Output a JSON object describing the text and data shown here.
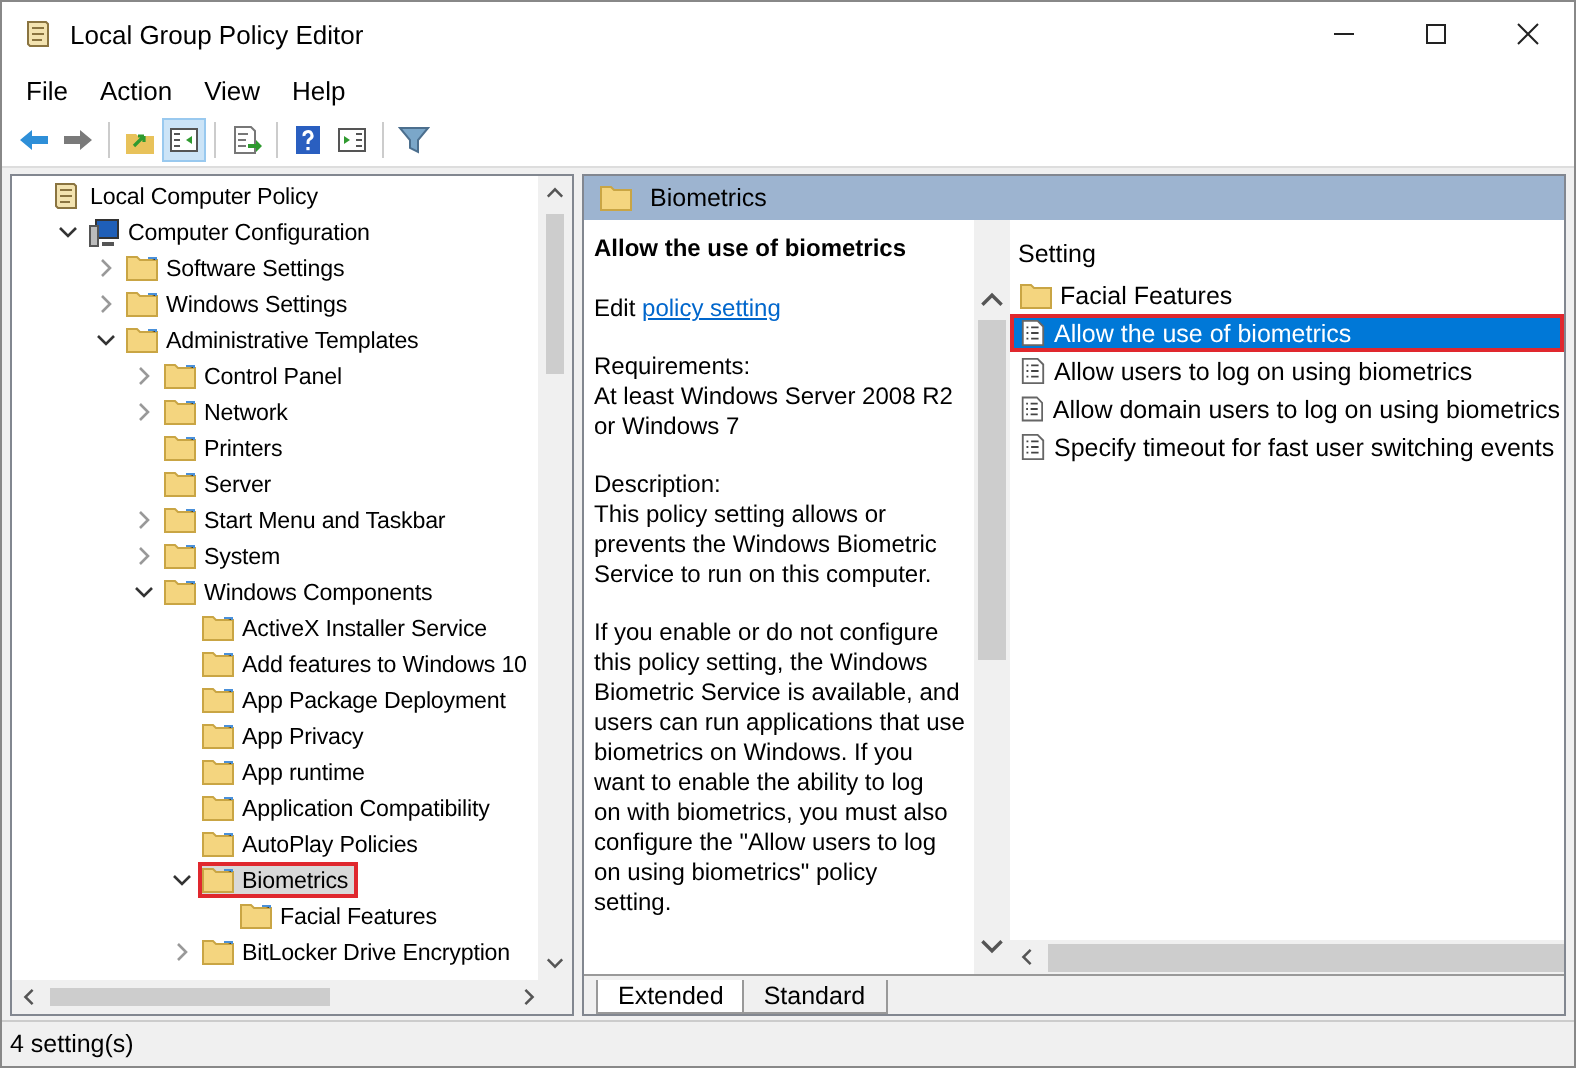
{
  "window": {
    "title": "Local Group Policy Editor"
  },
  "menu": [
    "File",
    "Action",
    "View",
    "Help"
  ],
  "toolbar": [
    {
      "kind": "back"
    },
    {
      "kind": "forward"
    },
    {
      "kind": "sep"
    },
    {
      "kind": "up"
    },
    {
      "kind": "tree",
      "selected": true
    },
    {
      "kind": "sep"
    },
    {
      "kind": "export"
    },
    {
      "kind": "sep"
    },
    {
      "kind": "help"
    },
    {
      "kind": "pane"
    },
    {
      "kind": "sep"
    },
    {
      "kind": "filter"
    }
  ],
  "tree": [
    {
      "label": "Local Computer Policy",
      "kind": "root",
      "selected": false,
      "highlighted": false,
      "children": [
        {
          "label": "Computer Configuration",
          "kind": "computer",
          "expanded": true,
          "selected": false,
          "highlighted": false,
          "children": [
            {
              "label": "Software Settings",
              "kind": "folder",
              "expanded": false,
              "selected": false,
              "highlighted": false
            },
            {
              "label": "Windows Settings",
              "kind": "folder",
              "expanded": false,
              "selected": false,
              "highlighted": false
            },
            {
              "label": "Administrative Templates",
              "kind": "folder",
              "expanded": true,
              "selected": false,
              "highlighted": false,
              "children": [
                {
                  "label": "Control Panel",
                  "kind": "folder",
                  "expanded": false,
                  "selected": false,
                  "highlighted": false
                },
                {
                  "label": "Network",
                  "kind": "folder",
                  "expanded": false,
                  "selected": false,
                  "highlighted": false
                },
                {
                  "label": "Printers",
                  "kind": "folder",
                  "selected": false,
                  "highlighted": false
                },
                {
                  "label": "Server",
                  "kind": "folder",
                  "selected": false,
                  "highlighted": false
                },
                {
                  "label": "Start Menu and Taskbar",
                  "kind": "folder",
                  "expanded": false,
                  "selected": false,
                  "highlighted": false
                },
                {
                  "label": "System",
                  "kind": "folder",
                  "expanded": false,
                  "selected": false,
                  "highlighted": false
                },
                {
                  "label": "Windows Components",
                  "kind": "folder",
                  "expanded": true,
                  "selected": false,
                  "highlighted": false,
                  "children": [
                    {
                      "label": "ActiveX Installer Service",
                      "kind": "folder",
                      "selected": false,
                      "highlighted": false
                    },
                    {
                      "label": "Add features to Windows 10",
                      "kind": "folder",
                      "selected": false,
                      "highlighted": false
                    },
                    {
                      "label": "App Package Deployment",
                      "kind": "folder",
                      "selected": false,
                      "highlighted": false
                    },
                    {
                      "label": "App Privacy",
                      "kind": "folder",
                      "selected": false,
                      "highlighted": false
                    },
                    {
                      "label": "App runtime",
                      "kind": "folder",
                      "selected": false,
                      "highlighted": false
                    },
                    {
                      "label": "Application Compatibility",
                      "kind": "folder",
                      "selected": false,
                      "highlighted": false
                    },
                    {
                      "label": "AutoPlay Policies",
                      "kind": "folder",
                      "selected": false,
                      "highlighted": false
                    },
                    {
                      "label": "Biometrics",
                      "kind": "folder",
                      "expanded": true,
                      "selected": true,
                      "highlighted": true,
                      "children": [
                        {
                          "label": "Facial Features",
                          "kind": "folder",
                          "selected": false,
                          "highlighted": false
                        }
                      ]
                    },
                    {
                      "label": "BitLocker Drive Encryption",
                      "kind": "folder",
                      "expanded": false,
                      "selected": false,
                      "highlighted": false
                    }
                  ]
                }
              ]
            }
          ]
        }
      ]
    }
  ],
  "details": {
    "header": "Biometrics",
    "title": "Allow the use of biometrics",
    "edit_prefix": "Edit",
    "edit_link": "policy setting",
    "paragraphs": [
      "Requirements:\nAt least Windows Server 2008 R2\nor Windows 7",
      "Description:\nThis policy setting allows or\nprevents the Windows Biometric\nService to run on this computer.",
      "If you enable or do not configure\nthis policy setting, the Windows\nBiometric Service is available, and\nusers can run applications that use\nbiometrics on Windows. If you\nwant to enable the ability to log\non with biometrics, you must also\nconfigure the \"Allow users to log\non using biometrics\" policy\nsetting."
    ]
  },
  "list": {
    "column": "Setting",
    "items": [
      {
        "label": "Facial Features",
        "kind": "folder",
        "selected": false,
        "highlighted": false
      },
      {
        "label": "Allow the use of biometrics",
        "kind": "setting",
        "selected": true,
        "highlighted": true
      },
      {
        "label": "Allow users to log on using biometrics",
        "kind": "setting",
        "selected": false,
        "highlighted": false
      },
      {
        "label": "Allow domain users to log on using biometrics",
        "kind": "setting",
        "selected": false,
        "highlighted": false
      },
      {
        "label": "Specify timeout for fast user switching events",
        "kind": "setting",
        "selected": false,
        "highlighted": false
      }
    ]
  },
  "tabs": [
    {
      "label": "Extended",
      "selected": true
    },
    {
      "label": "Standard",
      "selected": false
    }
  ],
  "status_bar": "4 setting(s)"
}
